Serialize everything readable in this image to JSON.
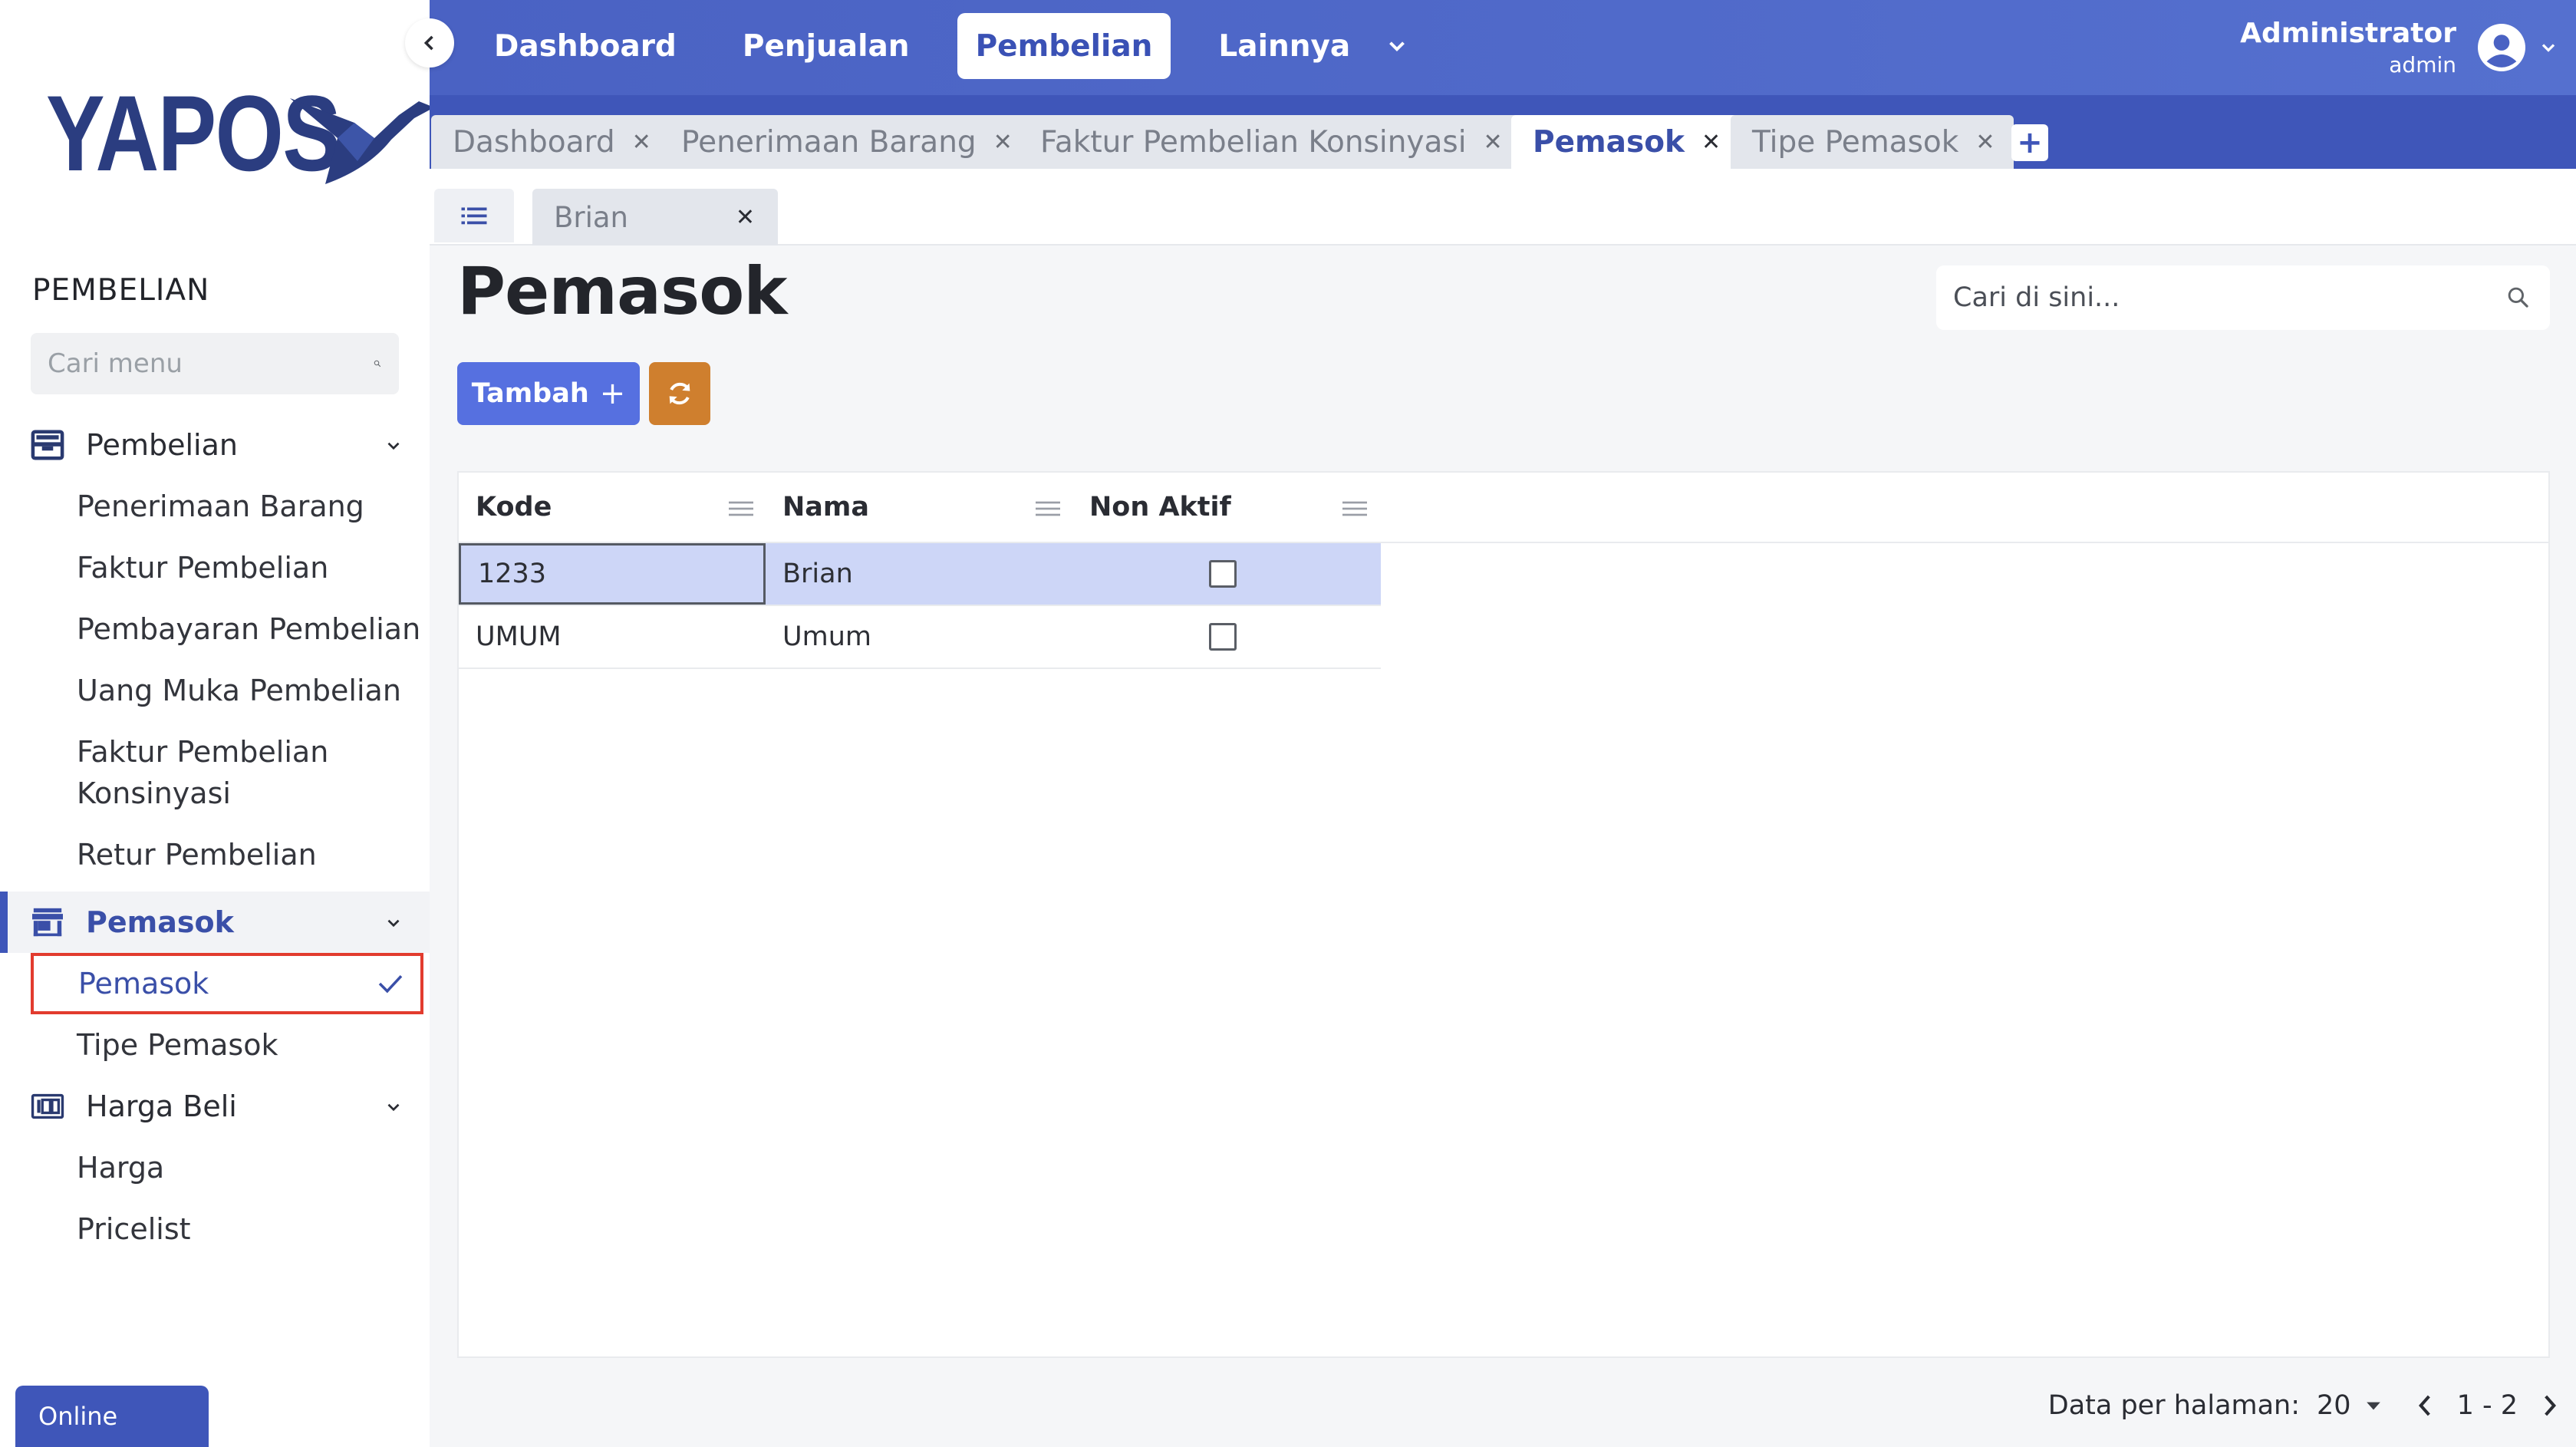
{
  "sidebar": {
    "logo_text": "YAPOS",
    "section_title": "PEMBELIAN",
    "search_placeholder": "Cari menu",
    "groups": [
      {
        "label": "Pembelian",
        "icon": "inbox-icon",
        "items": [
          "Penerimaan Barang",
          "Faktur Pembelian",
          "Pembayaran Pembelian",
          "Uang Muka Pembelian",
          "Faktur Pembelian Konsinyasi",
          "Retur Pembelian"
        ]
      },
      {
        "label": "Pemasok",
        "icon": "store-icon",
        "items": [
          "Pemasok",
          "Tipe Pemasok"
        ]
      },
      {
        "label": "Harga Beli",
        "icon": "price-icon",
        "items": [
          "Harga",
          "Pricelist"
        ]
      }
    ],
    "status": "Online"
  },
  "topnav": {
    "items": [
      "Dashboard",
      "Penjualan",
      "Pembelian",
      "Lainnya"
    ],
    "active": "Pembelian"
  },
  "user": {
    "name": "Administrator",
    "role": "admin"
  },
  "tabs": {
    "items": [
      "Dashboard",
      "Penerimaan Barang",
      "Faktur Pembelian Konsinyasi",
      "Pemasok",
      "Tipe Pemasok"
    ],
    "active": "Pemasok",
    "add_label": "+"
  },
  "subtabs": {
    "record": "Brian"
  },
  "page": {
    "title": "Pemasok",
    "search_placeholder": "Cari di sini...",
    "add_button": "Tambah",
    "add_plus": "+"
  },
  "table": {
    "columns": [
      "Kode",
      "Nama",
      "Non Aktif"
    ],
    "rows": [
      {
        "kode": "1233",
        "nama": "Brian",
        "non_aktif": false
      },
      {
        "kode": "UMUM",
        "nama": "Umum",
        "non_aktif": false
      }
    ]
  },
  "pagination": {
    "per_page_label": "Data per halaman:",
    "per_page": "20",
    "range": "1 - 2"
  },
  "colors": {
    "primary": "#3f56b9",
    "accent_orange": "#cf7f2e",
    "highlight_red": "#e23b2e",
    "row_selected": "#cdd6f7"
  }
}
